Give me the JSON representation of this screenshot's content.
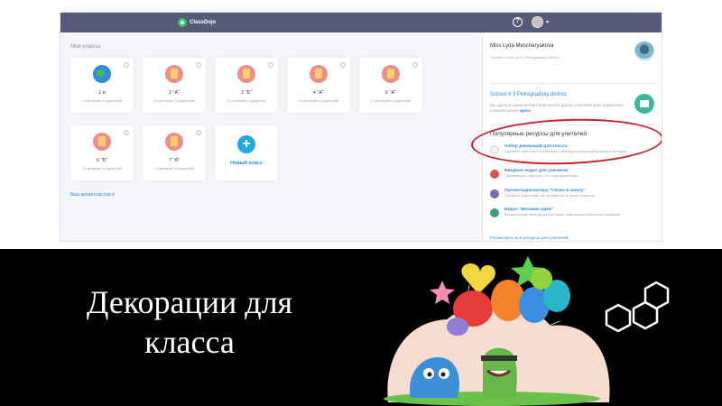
{
  "app": {
    "logo_text": "ClassDojo",
    "icons": {
      "help": "help-icon",
      "avatar": "user-avatar",
      "menu": "chevron-down-icon"
    }
  },
  "classes": {
    "section_title": "Мои классы",
    "items": [
      {
        "name": "1 в",
        "meta": "1 учеников 0 родителей",
        "icon": "globe"
      },
      {
        "name": "3 \"А\"",
        "meta": "14 учеников 3 родителей",
        "icon": "book"
      },
      {
        "name": "3 \"Б\"",
        "meta": "15 учеников 1 родитель",
        "icon": "book"
      },
      {
        "name": "4 \"А\"",
        "meta": "6 учеников 0 родителей",
        "icon": "book"
      },
      {
        "name": "6 \"А\"",
        "meta": "2 учеников 0 родителей",
        "icon": "book"
      },
      {
        "name": "6 \"Б\"",
        "meta": "3 учеников 0 родителей",
        "icon": "book"
      },
      {
        "name": "7 \"А\"",
        "meta": "2 учеников 0 родителей",
        "icon": "book"
      }
    ],
    "new_class_label": "Новый класс",
    "archive_link": "Ваш архив классов"
  },
  "profile": {
    "name": "Miss Lyda Mescheryakova",
    "school_line": "Учитель в School # 3 Petrogradsky district"
  },
  "school": {
    "title": "School # 3 Petrogradsky district",
    "text": "Вы здесь в одиночестве! Пригласите других учителей присоединиться к вашей школе",
    "link": "здесь"
  },
  "resources": {
    "title": "Популярные ресурсы для учителей",
    "items": [
      {
        "title": "Набор декораций для класса",
        "desc": "Сделайте свой класс особенным с помощью декораций монстра в постерах"
      },
      {
        "title": "Вводное видео для учеников",
        "desc": "Презентация ClassDojo с 90-секундным видео"
      },
      {
        "title": "Презентация вечера \"Снова в школу\"",
        "desc": "Покажите родителям, как оставаться на связи с классом"
      },
      {
        "title": "Видео \"Великие идеи\"",
        "desc": "Великолепные занятия для учеников, помогающие управлять эмоциями"
      }
    ],
    "all_link": "Посмотреть все ресурсы для учителей"
  },
  "slide": {
    "title_line1": "Декорации для",
    "title_line2": "класса"
  },
  "colors": {
    "header": "#555a78",
    "accent_blue": "#2a8ad6",
    "highlight_ring": "#c8202a",
    "slide_bg": "#000000"
  }
}
